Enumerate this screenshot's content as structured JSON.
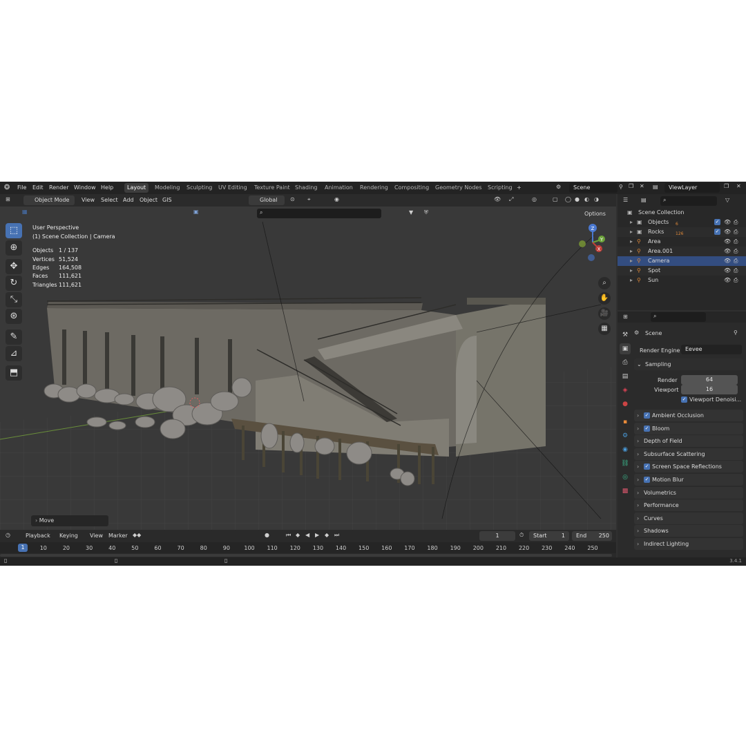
{
  "menu": {
    "items": [
      "File",
      "Edit",
      "Render",
      "Window",
      "Help"
    ]
  },
  "workspaces": {
    "tabs": [
      "Layout",
      "Modeling",
      "Sculpting",
      "UV Editing",
      "Texture Paint",
      "Shading",
      "Animation",
      "Rendering",
      "Compositing",
      "Geometry Nodes",
      "Scripting"
    ],
    "add": "+"
  },
  "scene": {
    "name": "Scene",
    "view_layer": "ViewLayer"
  },
  "viewport_header": {
    "mode": "Object Mode",
    "menus": [
      "View",
      "Select",
      "Add",
      "Object",
      "GIS"
    ],
    "orientation": "Global",
    "options": "Options"
  },
  "overlay": {
    "title": "User Perspective",
    "subtitle": "(1) Scene Collection | Camera",
    "stats": [
      {
        "label": "Objects",
        "value": "1 / 137"
      },
      {
        "label": "Vertices",
        "value": "51,524"
      },
      {
        "label": "Edges",
        "value": "164,508"
      },
      {
        "label": "Faces",
        "value": "111,621"
      },
      {
        "label": "Triangles",
        "value": "111,621"
      }
    ]
  },
  "gizmo": {
    "z": "Z",
    "y": "Y",
    "x": "X"
  },
  "last_operator": "Move",
  "outliner": {
    "root": "Scene Collection",
    "rows": [
      {
        "name": "Objects",
        "badge": "6",
        "selected": false
      },
      {
        "name": "Rocks",
        "badge": "126",
        "selected": false
      },
      {
        "name": "Area",
        "badge": "",
        "selected": false
      },
      {
        "name": "Area.001",
        "badge": "",
        "selected": false
      },
      {
        "name": "Camera",
        "badge": "",
        "selected": true
      },
      {
        "name": "Spot",
        "badge": "",
        "selected": false
      },
      {
        "name": "Sun",
        "badge": "",
        "selected": false
      }
    ]
  },
  "properties": {
    "context": "Scene",
    "render_engine_label": "Render Engine",
    "render_engine": "Eevee",
    "sampling": {
      "title": "Sampling",
      "render_label": "Render",
      "render_value": "64",
      "viewport_label": "Viewport",
      "viewport_value": "16",
      "denoise": "Viewport Denoisi..."
    },
    "panels": [
      {
        "label": "Ambient Occlusion",
        "checkbox": true
      },
      {
        "label": "Bloom",
        "checkbox": true
      },
      {
        "label": "Depth of Field",
        "checkbox": false
      },
      {
        "label": "Subsurface Scattering",
        "checkbox": false
      },
      {
        "label": "Screen Space Reflections",
        "checkbox": true
      },
      {
        "label": "Motion Blur",
        "checkbox": true
      },
      {
        "label": "Volumetrics",
        "checkbox": false
      },
      {
        "label": "Performance",
        "checkbox": false
      },
      {
        "label": "Curves",
        "checkbox": false
      },
      {
        "label": "Shadows",
        "checkbox": false
      },
      {
        "label": "Indirect Lighting",
        "checkbox": false
      }
    ]
  },
  "timeline": {
    "menus": [
      "Playback",
      "Keying",
      "View",
      "Marker"
    ],
    "current_frame": "1",
    "start_label": "Start",
    "start": "1",
    "end_label": "End",
    "end": "250",
    "ticks": [
      "1",
      "10",
      "20",
      "30",
      "40",
      "50",
      "60",
      "70",
      "80",
      "90",
      "100",
      "110",
      "120",
      "130",
      "140",
      "150",
      "160",
      "170",
      "180",
      "190",
      "200",
      "210",
      "220",
      "230",
      "240",
      "250"
    ]
  },
  "status": {
    "version": "3.4.1"
  },
  "colors": {
    "accent": "#4772b3",
    "selected_row": "#334d80",
    "background": "#303030"
  }
}
